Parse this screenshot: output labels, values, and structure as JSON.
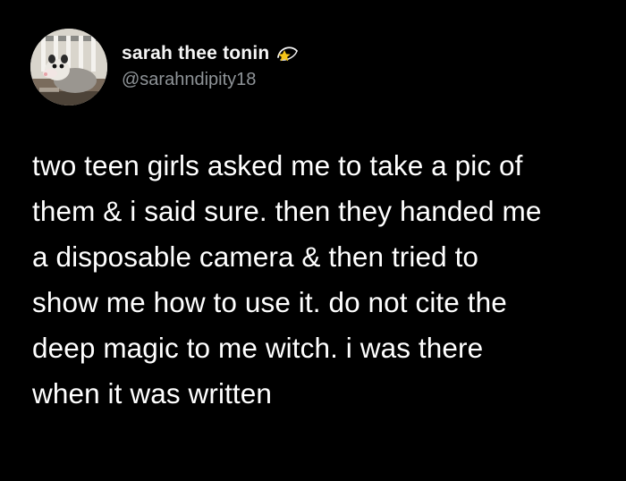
{
  "tweet": {
    "author": {
      "display_name": "sarah thee tonin",
      "handle": "@sarahndipity18",
      "name_emoji_icon": "dizzy-star-icon",
      "avatar_icon": "opossum-avatar-icon"
    },
    "text_lines": [
      "two teen girls asked me to take a pic of",
      "them & i said sure. then they handed me",
      "a disposable camera & then tried to",
      "show me how to use it. do not cite the",
      "deep magic to me witch. i was there",
      "when it was written"
    ]
  },
  "colors": {
    "background": "#000000",
    "text": "#ffffff",
    "handle": "#8f9498",
    "star": "#f5c518"
  }
}
